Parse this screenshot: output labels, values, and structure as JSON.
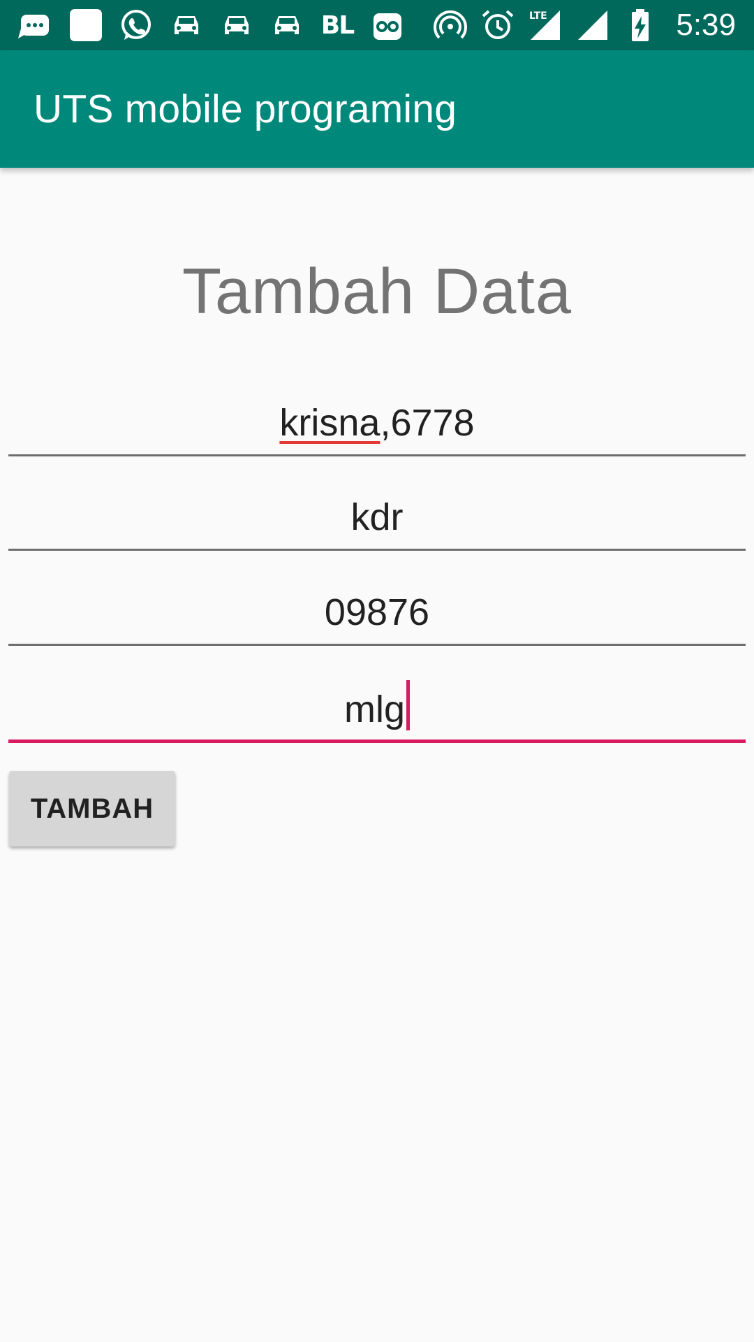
{
  "status_bar": {
    "left_icons": [
      "messages-icon",
      "square-app-icon",
      "whatsapp-icon",
      "car-icon",
      "car-icon",
      "car-icon",
      "bl-icon",
      "tripadvisor-owl-icon"
    ],
    "bl_label": "BL",
    "right_icons": [
      "hotspot-icon",
      "alarm-icon",
      "lte-signal-icon",
      "signal-icon",
      "battery-charging-icon"
    ],
    "lte_label": "LTE",
    "time": "5:39"
  },
  "app_bar": {
    "title": "UTS mobile programing"
  },
  "main": {
    "heading": "Tambah Data",
    "fields": [
      {
        "value_misspelled": "krisna",
        "value_rest": ",6778"
      },
      {
        "value": "kdr"
      },
      {
        "value": "09876"
      },
      {
        "value": "mlg",
        "focused": true
      }
    ],
    "submit_label": "TAMBAH"
  },
  "colors": {
    "status_bar": "#00695c",
    "app_bar": "#00897b",
    "accent": "#d81b60",
    "background": "#fafafa"
  }
}
